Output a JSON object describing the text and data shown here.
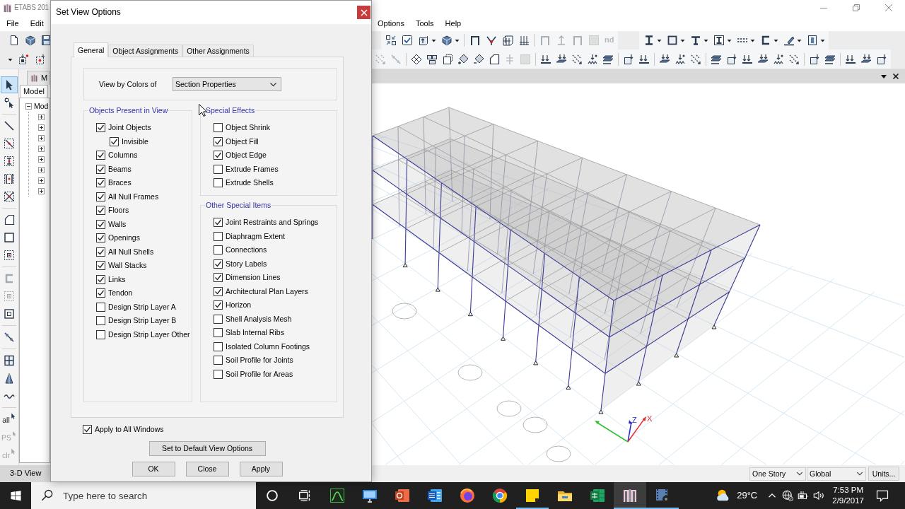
{
  "app": {
    "title": "ETABS 201",
    "menu_left": [
      "File",
      "Edit"
    ],
    "menu_right": [
      "Options",
      "Tools",
      "Help"
    ]
  },
  "toolbar_top": {
    "left": [
      {
        "kind": "icon",
        "disabled": false,
        "dropdown": false
      },
      {
        "kind": "icon",
        "disabled": false,
        "dropdown": false
      },
      {
        "kind": "icon",
        "disabled": false,
        "dropdown": false
      }
    ],
    "right": [
      {
        "groups": [
          [
            {
              "kind": "icon",
              "disabled": false,
              "dropdown": false
            },
            {
              "kind": "icon",
              "disabled": false,
              "dropdown": false
            },
            {
              "kind": "icon",
              "disabled": false,
              "dropdown": true
            },
            {
              "kind": "icon",
              "disabled": false,
              "dropdown": true
            }
          ],
          [
            {
              "kind": "icon",
              "disabled": false,
              "dropdown": false
            },
            {
              "kind": "icon",
              "disabled": false,
              "dropdown": false
            },
            {
              "kind": "icon",
              "disabled": false,
              "dropdown": false
            },
            {
              "kind": "icon",
              "disabled": false,
              "dropdown": false
            }
          ],
          [
            {
              "kind": "icon",
              "disabled": true,
              "dropdown": false
            },
            {
              "kind": "icon",
              "disabled": true,
              "dropdown": false
            },
            {
              "kind": "icon",
              "disabled": true,
              "dropdown": false
            },
            {
              "kind": "icon",
              "disabled": true,
              "dropdown": false
            },
            {
              "kind": "text",
              "label": "nd",
              "disabled": true,
              "dropdown": false
            }
          ]
        ]
      },
      {
        "groups": [
          [
            {
              "kind": "icon",
              "disabled": false,
              "dropdown": true
            },
            {
              "kind": "icon",
              "disabled": false,
              "dropdown": true
            },
            {
              "kind": "icon",
              "disabled": false,
              "dropdown": true
            },
            {
              "kind": "icon",
              "disabled": false,
              "dropdown": true
            },
            {
              "kind": "icon",
              "disabled": false,
              "dropdown": true
            },
            {
              "kind": "icon",
              "disabled": false,
              "dropdown": true
            },
            {
              "kind": "icon",
              "disabled": false,
              "dropdown": true
            },
            {
              "kind": "icon",
              "disabled": false,
              "dropdown": true
            }
          ]
        ]
      }
    ]
  },
  "toolbar_bottom": {
    "left": [
      {
        "kind": "icon",
        "disabled": false,
        "dropdown": false
      },
      {
        "kind": "icon",
        "disabled": false,
        "dropdown": false
      }
    ],
    "right": [
      {
        "groups": [
          [
            {
              "kind": "icon",
              "disabled": true,
              "dropdown": false
            },
            {
              "kind": "icon",
              "disabled": true,
              "dropdown": false
            }
          ],
          [
            {
              "kind": "icon",
              "disabled": false,
              "dropdown": false
            },
            {
              "kind": "icon",
              "disabled": false,
              "dropdown": false
            },
            {
              "kind": "icon",
              "disabled": false,
              "dropdown": false
            },
            {
              "kind": "icon",
              "disabled": false,
              "dropdown": false
            },
            {
              "kind": "icon",
              "disabled": false,
              "dropdown": false
            },
            {
              "kind": "icon",
              "disabled": false,
              "dropdown": false
            },
            {
              "kind": "icon",
              "disabled": true,
              "dropdown": false
            },
            {
              "kind": "icon",
              "disabled": true,
              "dropdown": false
            }
          ],
          [
            {
              "kind": "icon",
              "disabled": false,
              "dropdown": false
            },
            {
              "kind": "icon",
              "disabled": false,
              "dropdown": false
            },
            {
              "kind": "icon",
              "disabled": false,
              "dropdown": false
            },
            {
              "kind": "icon",
              "disabled": false,
              "dropdown": false
            },
            {
              "kind": "icon",
              "disabled": false,
              "dropdown": false
            }
          ],
          [
            {
              "kind": "icon",
              "disabled": false,
              "dropdown": false
            },
            {
              "kind": "icon",
              "disabled": false,
              "dropdown": false
            }
          ],
          [
            {
              "kind": "icon",
              "disabled": false,
              "dropdown": false
            },
            {
              "kind": "icon",
              "disabled": false,
              "dropdown": false
            },
            {
              "kind": "icon",
              "disabled": false,
              "dropdown": false
            }
          ],
          [
            {
              "kind": "icon",
              "disabled": false,
              "dropdown": false
            },
            {
              "kind": "icon",
              "disabled": false,
              "dropdown": false
            },
            {
              "kind": "icon",
              "disabled": false,
              "dropdown": false
            },
            {
              "kind": "icon",
              "disabled": false,
              "dropdown": false
            },
            {
              "kind": "icon",
              "disabled": false,
              "dropdown": false
            },
            {
              "kind": "icon",
              "disabled": false,
              "dropdown": false
            }
          ],
          [
            {
              "kind": "icon",
              "disabled": false,
              "dropdown": false
            },
            {
              "kind": "icon",
              "disabled": false,
              "dropdown": false
            }
          ],
          [
            {
              "kind": "icon",
              "disabled": false,
              "dropdown": false
            },
            {
              "kind": "icon",
              "disabled": false,
              "dropdown": false
            },
            {
              "kind": "icon",
              "disabled": false,
              "dropdown": false
            }
          ]
        ]
      }
    ]
  },
  "tool_strip": [
    {
      "kind": "icon",
      "selected": true,
      "disabled": false
    },
    {
      "kind": "icon",
      "selected": false,
      "disabled": false
    },
    {
      "kind": "icon",
      "selected": false,
      "disabled": false
    },
    {
      "kind": "icon",
      "selected": false,
      "disabled": false
    },
    {
      "kind": "icon",
      "selected": false,
      "disabled": false
    },
    {
      "kind": "icon",
      "selected": false,
      "disabled": false
    },
    {
      "kind": "icon",
      "selected": false,
      "disabled": false
    },
    {
      "kind": "icon",
      "selected": false,
      "disabled": false
    },
    {
      "kind": "icon",
      "selected": false,
      "disabled": false
    },
    {
      "kind": "icon",
      "selected": false,
      "disabled": false
    },
    {
      "kind": "icon",
      "selected": false,
      "disabled": true
    },
    {
      "kind": "icon",
      "selected": false,
      "disabled": true
    },
    {
      "kind": "icon",
      "selected": false,
      "disabled": false
    },
    {
      "kind": "icon",
      "selected": false,
      "disabled": false
    },
    {
      "kind": "icon",
      "selected": false,
      "disabled": false
    },
    {
      "kind": "icon",
      "selected": false,
      "disabled": false
    },
    {
      "kind": "icon",
      "selected": false,
      "disabled": false
    },
    {
      "kind": "text",
      "label": "all",
      "selected": false,
      "disabled": false
    },
    {
      "kind": "text",
      "label": "PS",
      "selected": false,
      "disabled": true
    },
    {
      "kind": "text",
      "label": "clr",
      "selected": false,
      "disabled": true
    }
  ],
  "explorer": {
    "window_tab": "M",
    "tabs": [
      {
        "label": "Model",
        "selected": true
      }
    ],
    "tree": {
      "label": "Mod",
      "expanded": true,
      "children": [
        {
          "expanded": false
        },
        {
          "expanded": false
        },
        {
          "expanded": false
        },
        {
          "expanded": false
        },
        {
          "expanded": false
        },
        {
          "expanded": false
        },
        {
          "expanded": false
        },
        {
          "expanded": false
        }
      ]
    }
  },
  "view_tab": "3-D View",
  "model_view": {
    "axis_labels": {
      "z": "Z",
      "x": "X"
    }
  },
  "status_bar": {
    "story": "One Story",
    "coordinates": "Global",
    "units_button": "Units..."
  },
  "dialog": {
    "title": "Set View Options",
    "tabs": [
      {
        "label": "General",
        "selected": true
      },
      {
        "label": "Object Assignments",
        "selected": false
      },
      {
        "label": "Other Assignments",
        "selected": false
      }
    ],
    "color_by": {
      "label": "View by Colors of",
      "value": "Section Properties"
    },
    "groups": [
      {
        "title": "Objects Present in View",
        "items": [
          {
            "label": "Joint Objects",
            "checked": true,
            "children": [
              {
                "label": "Invisible",
                "checked": true
              }
            ]
          },
          {
            "label": "Columns",
            "checked": true
          },
          {
            "label": "Beams",
            "checked": true
          },
          {
            "label": "Braces",
            "checked": true
          },
          {
            "label": "All Null Frames",
            "checked": true
          },
          {
            "label": "Floors",
            "checked": true
          },
          {
            "label": "Walls",
            "checked": true
          },
          {
            "label": "Openings",
            "checked": true
          },
          {
            "label": "All Null Shells",
            "checked": true
          },
          {
            "label": "Wall Stacks",
            "checked": true
          },
          {
            "label": "Links",
            "checked": true
          },
          {
            "label": "Tendon",
            "checked": true
          },
          {
            "label": "Design Strip Layer A",
            "checked": false
          },
          {
            "label": "Design Strip Layer B",
            "checked": false
          },
          {
            "label": "Design Strip Layer Other",
            "checked": false
          }
        ]
      },
      {
        "title": "Special Effects",
        "items": [
          {
            "label": "Object Shrink",
            "checked": false
          },
          {
            "label": "Object Fill",
            "checked": true
          },
          {
            "label": "Object Edge",
            "checked": true
          },
          {
            "label": "Extrude Frames",
            "checked": false
          },
          {
            "label": "Extrude Shells",
            "checked": false
          }
        ]
      },
      {
        "title": "Other Special Items",
        "items": [
          {
            "label": "Joint Restraints and Springs",
            "checked": true
          },
          {
            "label": "Diaphragm Extent",
            "checked": false
          },
          {
            "label": "Connections",
            "checked": false
          },
          {
            "label": "Story Labels",
            "checked": true
          },
          {
            "label": "Dimension Lines",
            "checked": true
          },
          {
            "label": "Architectural Plan Layers",
            "checked": true
          },
          {
            "label": "Horizon",
            "checked": true
          },
          {
            "label": "Shell Analysis Mesh",
            "checked": false
          },
          {
            "label": "Slab Internal Ribs",
            "checked": false
          },
          {
            "label": "Isolated Column Footings",
            "checked": false
          },
          {
            "label": "Soil Profile for Joints",
            "checked": false
          },
          {
            "label": "Soil Profile for Areas",
            "checked": false
          }
        ]
      }
    ],
    "apply_all": {
      "label": "Apply to All Windows",
      "checked": true
    },
    "default_button": "Set to Default View Options",
    "buttons": [
      "OK",
      "Close",
      "Apply"
    ]
  },
  "taskbar": {
    "search": {
      "placeholder": "Type here to search"
    },
    "apps": [
      {
        "running": false,
        "selected": false
      },
      {
        "running": false,
        "selected": false
      },
      {
        "running": false,
        "selected": false
      },
      {
        "running": false,
        "selected": false
      },
      {
        "running": false,
        "selected": false
      },
      {
        "running": false,
        "selected": false
      },
      {
        "running": true,
        "selected": false
      },
      {
        "running": false,
        "selected": false
      },
      {
        "running": false,
        "selected": false
      },
      {
        "running": true,
        "selected": true
      },
      {
        "running": true,
        "selected": false
      }
    ],
    "temperature": "29°C",
    "time": "7:53 PM",
    "date": "2/9/2017"
  }
}
